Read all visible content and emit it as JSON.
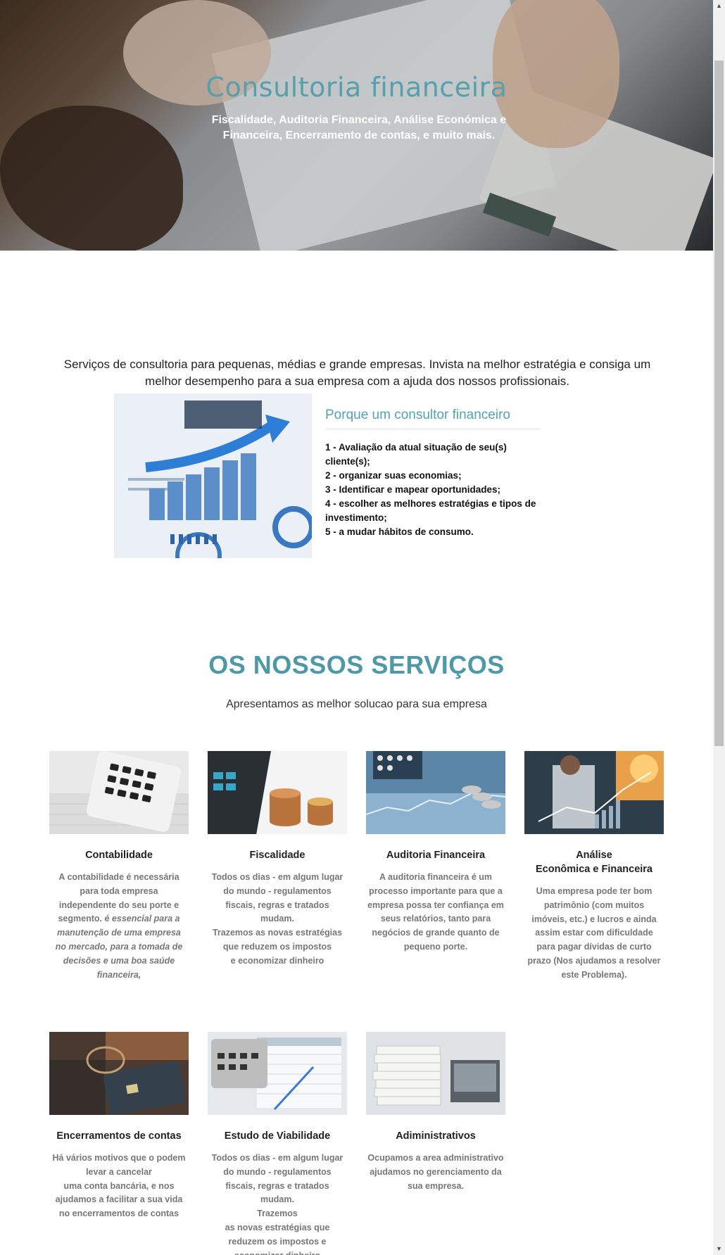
{
  "hero": {
    "title": "Consultoria financeira",
    "subtitle": "Fiscalidade, Auditoria Financeira, Análise Económica e Financeira, Encerramento de contas, e muito mais."
  },
  "intro": {
    "text": "Serviços de consultoria para pequenas, médias e grande empresas. Invista na melhor estratégia e consiga um melhor desempenho para a sua empresa com a ajuda dos nossos profissionais."
  },
  "why": {
    "title": "Porque um consultor financeiro",
    "items": [
      "1 -  Avaliação da atual situação de seu(s) cliente(s);",
      "2 - organizar suas economias;",
      "3 - Identificar e mapear oportunidades;",
      "4 - escolher as melhores estratégias e tipos de investimento;",
      "5 - a mudar hábitos de consumo."
    ]
  },
  "services": {
    "title": "OS NOSSOS SERVIÇOS",
    "subtitle": "Apresentamos as melhor solucao para sua empresa",
    "cards": [
      {
        "title": "Contabilidade",
        "desc_plain": "A contabilidade é necessária para toda empresa independente do seu porte e segmento. ",
        "desc_italic": "é essencial para a manutenção de uma empresa no mercado, para a tomada de decisões e uma boa saúde financeira,"
      },
      {
        "title": "Fiscalidade",
        "desc": "Todos os dias - em algum lugar do mundo - regulamentos fiscais, regras e tratados mudam.\nTrazemos as novas estratégias que reduzem os impostos\ne economizar dinheiro"
      },
      {
        "title": "Auditoria Financeira",
        "desc": "A auditoria financeira é um processo importante para que a empresa possa ter confiança em seus relatórios, tanto para negócios de grande quanto de pequeno porte."
      },
      {
        "title": "Análise\nEconômica e Financeira",
        "desc": "Uma empresa pode ter bom patrimônio (com muitos imóveis, etc.) e lucros  e ainda assim estar com dificuldade para pagar dívidas de curto prazo (Nos ajudamos a resolver este Problema)."
      },
      {
        "title": "Encerramentos de contas",
        "desc": "Há vários motivos que o podem levar a cancelar\numa conta bancária, e nos ajudamos a facilitar a sua vida no encerramentos de contas"
      },
      {
        "title": "Estudo de Viabilidade",
        "desc": "Todos os dias - em algum lugar do mundo - regulamentos fiscais, regras e tratados mudam.\nTrazemos\nas novas estratégias que reduzem os impostos e economizar dinheiro"
      },
      {
        "title": "Adiministrativos",
        "desc": "Ocupamos a area administrativo ajudamos no gerenciamento da sua empresa."
      }
    ]
  }
}
